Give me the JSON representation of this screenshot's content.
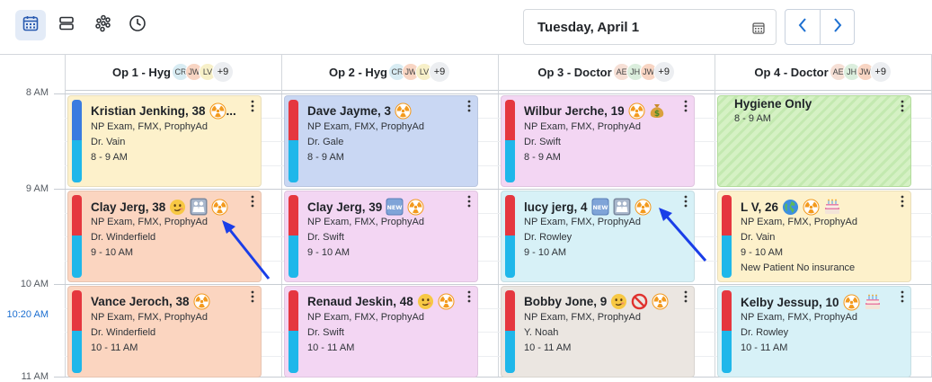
{
  "toolbar": {
    "date": "Tuesday, April 1"
  },
  "times": [
    {
      "label": "8 AM",
      "current": false
    },
    {
      "label": "9 AM",
      "current": false
    },
    {
      "label": "10 AM",
      "current": false
    },
    {
      "label": "10:20 AM",
      "current": true
    },
    {
      "label": "11 AM",
      "current": false
    }
  ],
  "columns": [
    {
      "title": "Op 1 - Hyg",
      "avatars": [
        "CR",
        "JW",
        "LV"
      ],
      "more": "+9"
    },
    {
      "title": "Op 2 - Hyg",
      "avatars": [
        "CR",
        "JW",
        "LV"
      ],
      "more": "+9"
    },
    {
      "title": "Op 3 - Doctor",
      "avatars": [
        "AE",
        "JH",
        "JW"
      ],
      "more": "+9"
    },
    {
      "title": "Op 4 - Doctor",
      "avatars": [
        "AE",
        "JH",
        "JW"
      ],
      "more": "+9"
    }
  ],
  "colors": {
    "accent": "#1c6fd1",
    "stripe_red": "#e5373f",
    "stripe_blue": "#1fb7ea",
    "stripe_darkblue": "#3a7be0",
    "yellow": "#fdf1cb",
    "blue": "#c9d7f3",
    "pink": "#f3d6f3",
    "peach": "#fbd5c0",
    "light_blue": "#d7f1f7",
    "gray": "#ebe6e1"
  },
  "appointments": [
    {
      "col": 0,
      "row": 0,
      "name": "Kristian Jenking, 38",
      "icons": [
        "radiation"
      ],
      "ellipsis": "...",
      "procedure": "NP Exam, FMX, ProphyAd",
      "provider": "Dr. Vain",
      "time": "8 - 9 AM",
      "note": "",
      "bg": "yellow",
      "top": "darkblue"
    },
    {
      "col": 1,
      "row": 0,
      "name": "Dave Jayme, 3",
      "icons": [
        "radiation"
      ],
      "ellipsis": "",
      "procedure": "NP Exam, FMX, ProphyAd",
      "provider": "Dr. Gale",
      "time": "8 - 9 AM",
      "note": "",
      "bg": "blue",
      "top": "red"
    },
    {
      "col": 2,
      "row": 0,
      "name": "Wilbur Jerche, 19",
      "icons": [
        "radiation",
        "money"
      ],
      "ellipsis": "",
      "procedure": "NP Exam, FMX, ProphyAd",
      "provider": "Dr. Swift",
      "time": "8 - 9 AM",
      "note": "",
      "bg": "pink",
      "top": "red"
    },
    {
      "col": 0,
      "row": 1,
      "name": "Clay Jerg, 38",
      "icons": [
        "smirk",
        "family",
        "radiation"
      ],
      "ellipsis": "",
      "procedure": "NP Exam, FMX, ProphyAd",
      "provider": "Dr. Winderfield",
      "time": "9 - 10 AM",
      "note": "",
      "bg": "peach",
      "top": "red"
    },
    {
      "col": 1,
      "row": 1,
      "name": "Clay Jerg, 39",
      "icons": [
        "new",
        "radiation"
      ],
      "ellipsis": "",
      "procedure": "NP Exam, FMX, ProphyAd",
      "provider": "Dr. Swift",
      "time": "9 - 10 AM",
      "note": "",
      "bg": "pink",
      "top": "red"
    },
    {
      "col": 2,
      "row": 1,
      "name": "lucy jerg, 4",
      "icons": [
        "new",
        "family",
        "radiation"
      ],
      "ellipsis": "",
      "procedure": "NP Exam, FMX, ProphyAd",
      "provider": "Dr. Rowley",
      "time": "9 - 10 AM",
      "note": "",
      "bg": "light_blue",
      "top": "red"
    },
    {
      "col": 3,
      "row": 1,
      "name": "L V, 26",
      "icons": [
        "globe",
        "radiation",
        "cake"
      ],
      "ellipsis": "",
      "procedure": "NP Exam, FMX, ProphyAd",
      "provider": "Dr. Vain",
      "time": "9 - 10 AM",
      "note": "New Patient No insurance",
      "bg": "yellow",
      "top": "red"
    },
    {
      "col": 0,
      "row": 2,
      "name": "Vance Jeroch, 38",
      "icons": [
        "radiation"
      ],
      "ellipsis": "",
      "procedure": "NP Exam, FMX, ProphyAd",
      "provider": "Dr. Winderfield",
      "time": "10 - 11 AM",
      "note": "",
      "bg": "peach",
      "top": "red"
    },
    {
      "col": 1,
      "row": 2,
      "name": "Renaud Jeskin, 48",
      "icons": [
        "smirk",
        "radiation"
      ],
      "ellipsis": "",
      "procedure": "NP Exam, FMX, ProphyAd",
      "provider": "Dr. Swift",
      "time": "10 - 11 AM",
      "note": "",
      "bg": "pink",
      "top": "red"
    },
    {
      "col": 2,
      "row": 2,
      "name": "Bobby Jone, 9",
      "icons": [
        "smirk",
        "prohibited",
        "radiation"
      ],
      "ellipsis": "",
      "procedure": "NP Exam, FMX, ProphyAd",
      "provider": "Y. Noah",
      "time": "10 - 11 AM",
      "note": "",
      "bg": "gray",
      "top": "red"
    },
    {
      "col": 3,
      "row": 2,
      "name": "Kelby Jessup, 10",
      "icons": [
        "radiation",
        "cake"
      ],
      "ellipsis": "",
      "procedure": "NP Exam, FMX, ProphyAd",
      "provider": "Dr. Rowley",
      "time": "10 - 11 AM",
      "note": "",
      "bg": "light_blue",
      "top": "red"
    }
  ],
  "blocks": [
    {
      "col": 3,
      "row": 0,
      "title": "Hygiene Only",
      "time": "8 - 9 AM"
    }
  ]
}
